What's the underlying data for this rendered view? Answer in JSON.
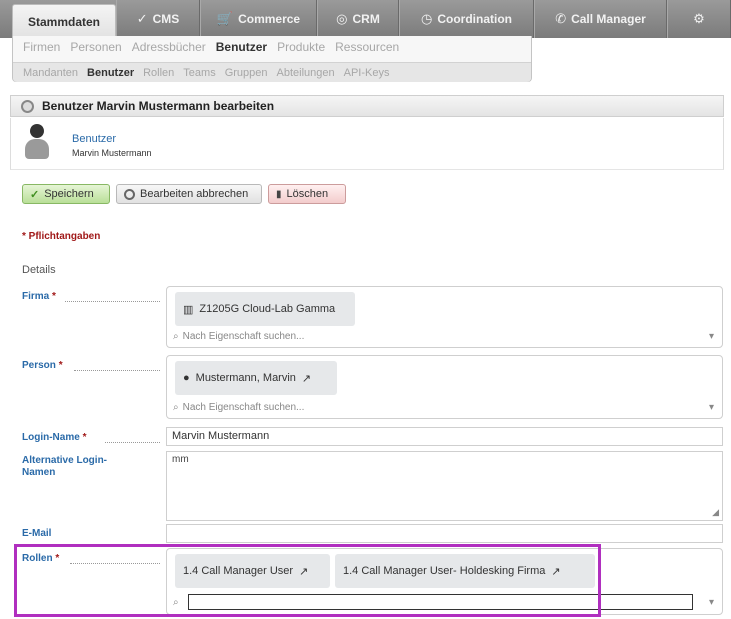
{
  "topnav": {
    "tabs": [
      {
        "label": "Stammdaten",
        "icon": ""
      },
      {
        "label": "CMS",
        "icon": "✓"
      },
      {
        "label": "Commerce",
        "icon": "🛒"
      },
      {
        "label": "CRM",
        "icon": "◎"
      },
      {
        "label": "Coordination",
        "icon": "◷"
      },
      {
        "label": "Call Manager",
        "icon": "✆"
      },
      {
        "label": "",
        "icon": "⚙"
      }
    ]
  },
  "submenu": {
    "row1": [
      "Firmen",
      "Personen",
      "Adressbücher",
      "Benutzer",
      "Produkte",
      "Ressourcen"
    ],
    "row1_selected": "Benutzer",
    "row2": [
      "Mandanten",
      "Benutzer",
      "Rollen",
      "Teams",
      "Gruppen",
      "Abteilungen",
      "API-Keys"
    ],
    "row2_selected": "Benutzer"
  },
  "panel": {
    "title": "Benutzer Marvin Mustermann bearbeiten",
    "entity_type": "Benutzer",
    "entity_name": "Marvin Mustermann"
  },
  "buttons": {
    "save": "Speichern",
    "cancel": "Bearbeiten abbrechen",
    "delete": "Löschen"
  },
  "required_note": "* Pflichtangaben",
  "section_title": "Details",
  "form": {
    "firma": {
      "label": "Firma",
      "chip": "Z1205G Cloud-Lab Gamma",
      "search_placeholder": "Nach Eigenschaft suchen..."
    },
    "person": {
      "label": "Person",
      "chip": "Mustermann, Marvin",
      "search_placeholder": "Nach Eigenschaft suchen..."
    },
    "login_name": {
      "label": "Login-Name",
      "value": "Marvin Mustermann"
    },
    "alt_login": {
      "label": "Alternative Login-Namen",
      "value": "mm"
    },
    "email": {
      "label": "E-Mail",
      "value": ""
    },
    "rollen": {
      "label": "Rollen",
      "chips": [
        "1.4 Call Manager User",
        "1.4 Call Manager User- Holdesking Firma"
      ]
    }
  },
  "colors": {
    "highlight": "#b02fbf",
    "link_blue": "#2a6aa8",
    "required_red": "#a01818"
  }
}
